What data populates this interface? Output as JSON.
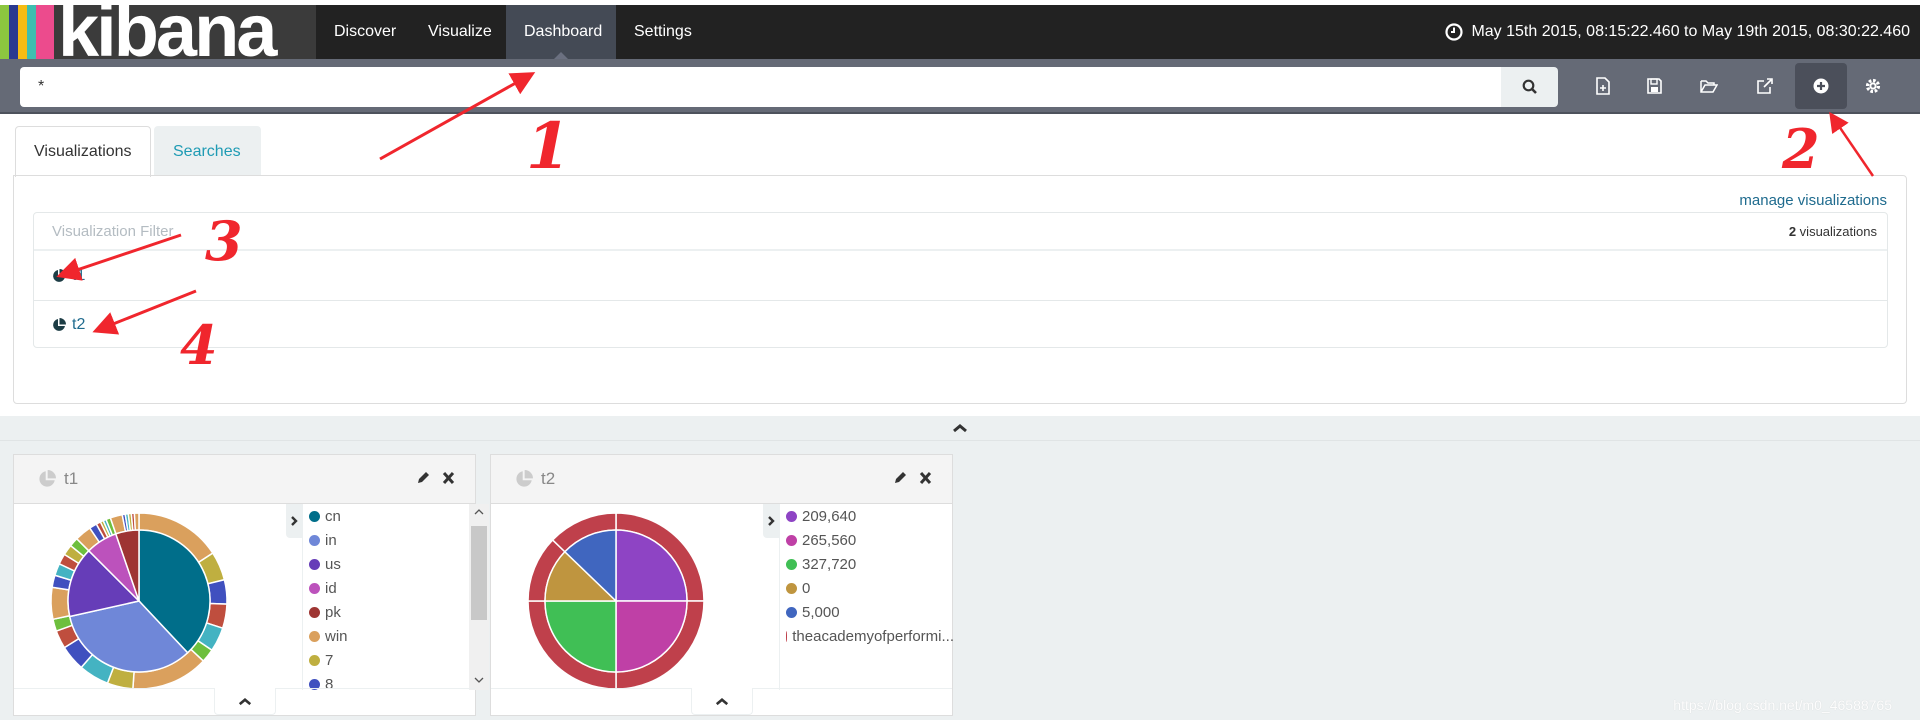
{
  "app": {
    "logo": "kibana",
    "logo_colors": [
      "#8cc63f",
      "#2b3990",
      "#f6bc13",
      "#3ebeb0",
      "#ec4b8d"
    ]
  },
  "nav": {
    "items": [
      {
        "label": "Discover"
      },
      {
        "label": "Visualize"
      },
      {
        "label": "Dashboard",
        "active": true
      },
      {
        "label": "Settings"
      }
    ]
  },
  "timepicker": {
    "icon": "clock-icon",
    "label": "May 15th 2015, 08:15:22.460 to May 19th 2015, 08:30:22.460"
  },
  "search": {
    "value": "*",
    "button_icon": "search-icon"
  },
  "toolbar": {
    "icons": [
      "new-dashboard-icon",
      "save-icon",
      "open-icon",
      "share-icon",
      "add-visualization-icon",
      "options-gear-icon"
    ],
    "active": "add-visualization-icon"
  },
  "add_panel": {
    "tabs": [
      {
        "label": "Visualizations",
        "active": true
      },
      {
        "label": "Searches"
      }
    ],
    "manage_link": "manage visualizations",
    "filter_placeholder": "Visualization Filter",
    "count_number": "2",
    "count_label": " visualizations",
    "items": [
      {
        "label": "t1",
        "icon": "pie-chart-icon"
      },
      {
        "label": "t2",
        "icon": "pie-chart-icon"
      }
    ]
  },
  "annotations": [
    "1",
    "2",
    "3",
    "4"
  ],
  "annotation_color": "#f0262d",
  "panels": [
    {
      "title": "t1",
      "legend": [
        {
          "label": "cn",
          "color": "#006e8a"
        },
        {
          "label": "in",
          "color": "#6f87d8"
        },
        {
          "label": "us",
          "color": "#663db8"
        },
        {
          "label": "id",
          "color": "#bc52bc"
        },
        {
          "label": "pk",
          "color": "#9e3533"
        },
        {
          "label": "win",
          "color": "#daa05d"
        },
        {
          "label": "7",
          "color": "#bfaf40"
        },
        {
          "label": "8",
          "color": "#4050bf"
        }
      ]
    },
    {
      "title": "t2",
      "legend": [
        {
          "label": "209,640",
          "color": "#8e44c4"
        },
        {
          "label": "265,560",
          "color": "#bf40a6"
        },
        {
          "label": "327,720",
          "color": "#40bf55"
        },
        {
          "label": "0",
          "color": "#bf953f"
        },
        {
          "label": "5,000",
          "color": "#4066bf"
        },
        {
          "label": "theacademyofperformi...",
          "color": "#bf404b"
        }
      ]
    }
  ],
  "chart_data": [
    {
      "type": "pie",
      "donut_sunburst": true,
      "inner_shares_percent": [
        38,
        33.5,
        16,
        7.2,
        5.3
      ],
      "inner_colors": [
        "#006e8a",
        "#6f87d8",
        "#663db8",
        "#bc52bc",
        "#9e3533"
      ],
      "outer_shares": [
        57,
        19,
        16,
        16,
        16,
        9,
        51,
        17,
        20,
        17,
        12,
        8,
        21,
        8,
        8,
        7,
        7,
        6,
        11,
        5,
        3,
        2,
        2,
        3,
        8,
        2,
        2,
        2,
        2,
        3
      ],
      "outer_colors": [
        "#daa05d",
        "#bfaf40",
        "#4050bf",
        "#bf4e3e",
        "#44b3c2",
        "#6dbf3d",
        "#daa05d",
        "#bfaf40",
        "#44b3c2",
        "#4050bf",
        "#bf4e3e",
        "#6dbf3d",
        "#daa05d",
        "#4050bf",
        "#44b3c2",
        "#bf4e3e",
        "#bfaf40",
        "#6dbf3d",
        "#daa05d",
        "#4050bf",
        "#bf4e3e",
        "#bfaf40",
        "#44b3c2",
        "#6dbf3d",
        "#daa05d",
        "#4050bf",
        "#44b3c2",
        "#bfaf40",
        "#bf4e3e",
        "#daa05d"
      ]
    },
    {
      "type": "pie",
      "donut_sunburst": true,
      "inner_shares_percent": [
        25,
        25,
        25,
        12.2,
        12.8
      ],
      "inner_colors": [
        "#8e44c4",
        "#bf40a6",
        "#40bf55",
        "#bf953f",
        "#4066bf"
      ],
      "outer_shares": [
        25,
        25,
        25,
        12.2,
        12.8
      ],
      "outer_colors": [
        "#bf404b",
        "#bf404b",
        "#bf404b",
        "#bf404b",
        "#bf404b"
      ]
    }
  ],
  "watermark": "https://blog.csdn.net/m0_46588765"
}
